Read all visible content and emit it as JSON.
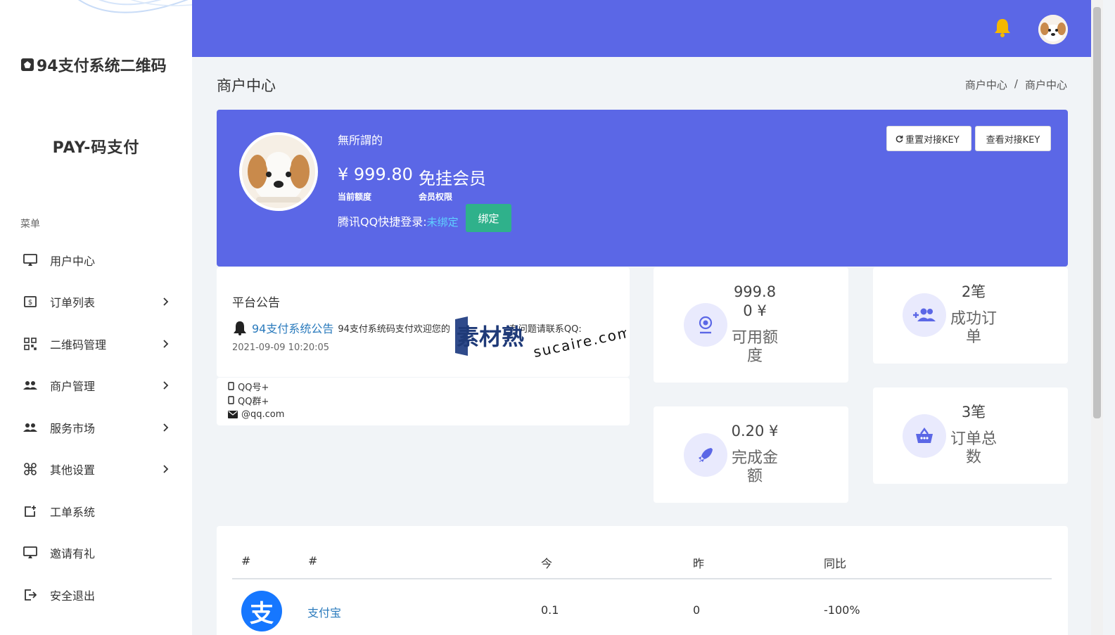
{
  "brand": {
    "title": "94支付系统二维码",
    "subtitle": "PAY-码支付"
  },
  "sidebar": {
    "menu_title": "菜单",
    "items": [
      {
        "label": "用户中心",
        "icon": "monitor-icon",
        "has_children": false
      },
      {
        "label": "订单列表",
        "icon": "dollar-box-icon",
        "has_children": true
      },
      {
        "label": "二维码管理",
        "icon": "qrcode-icon",
        "has_children": true
      },
      {
        "label": "商户管理",
        "icon": "users-icon",
        "has_children": true
      },
      {
        "label": "服务市场",
        "icon": "users-icon",
        "has_children": true
      },
      {
        "label": "其他设置",
        "icon": "command-icon",
        "has_children": true
      },
      {
        "label": "工单系统",
        "icon": "add-box-icon",
        "has_children": false
      },
      {
        "label": "邀请有礼",
        "icon": "monitor-icon",
        "has_children": false
      },
      {
        "label": "安全退出",
        "icon": "logout-icon",
        "has_children": false
      }
    ]
  },
  "page": {
    "title": "商户中心",
    "breadcrumb": [
      "商户中心",
      "/",
      "商户中心"
    ]
  },
  "profile": {
    "username": "無所謂的",
    "balance": "¥ 999.80",
    "balance_label": "当前额度",
    "membership": "免挂会员",
    "membership_label": "会员权限",
    "qq_label": "腾讯QQ快捷登录:",
    "qq_status": "未绑定",
    "bind_button": "绑定",
    "reset_key_button": "重置对接KEY",
    "view_key_button": "查看对接KEY"
  },
  "notice": {
    "title": "平台公告",
    "link": "94支付系统公告",
    "text": "94支付系统码支付欢迎您的",
    "text_tail": "有问题请联系QQ:",
    "time": "2021-09-09 10:20:05",
    "contacts": [
      "QQ号+",
      "QQ群+",
      "@qq.com"
    ]
  },
  "watermark": {
    "cn": "素材熟",
    "en": "sucaire.com"
  },
  "stats": [
    {
      "value_line1": "999.8",
      "value_line2": "0 ¥",
      "label_line1": "可用额",
      "label_line2": "度",
      "icon": "webcam-icon"
    },
    {
      "value_line1": "2笔",
      "label_line1": "成功订",
      "label_line2": "单",
      "icon": "user-plus-icon"
    },
    {
      "value_line1": "0.20 ¥",
      "label_line1": "完成金",
      "label_line2": "额",
      "icon": "rocket-icon"
    },
    {
      "value_line1": "3笔",
      "label_line1": "订单总",
      "label_line2": "数",
      "icon": "basket-icon"
    }
  ],
  "table": {
    "headers": [
      "#",
      "#",
      "今",
      "昨",
      "同比"
    ],
    "rows": [
      {
        "icon_text": "支",
        "name": "支付宝",
        "today": "0.1",
        "yesterday": "0",
        "ratio": "-100%"
      }
    ]
  },
  "colors": {
    "primary": "#5b67e6",
    "success": "#2fb18b",
    "link": "#2b7bbd",
    "alipay": "#1677ff"
  }
}
